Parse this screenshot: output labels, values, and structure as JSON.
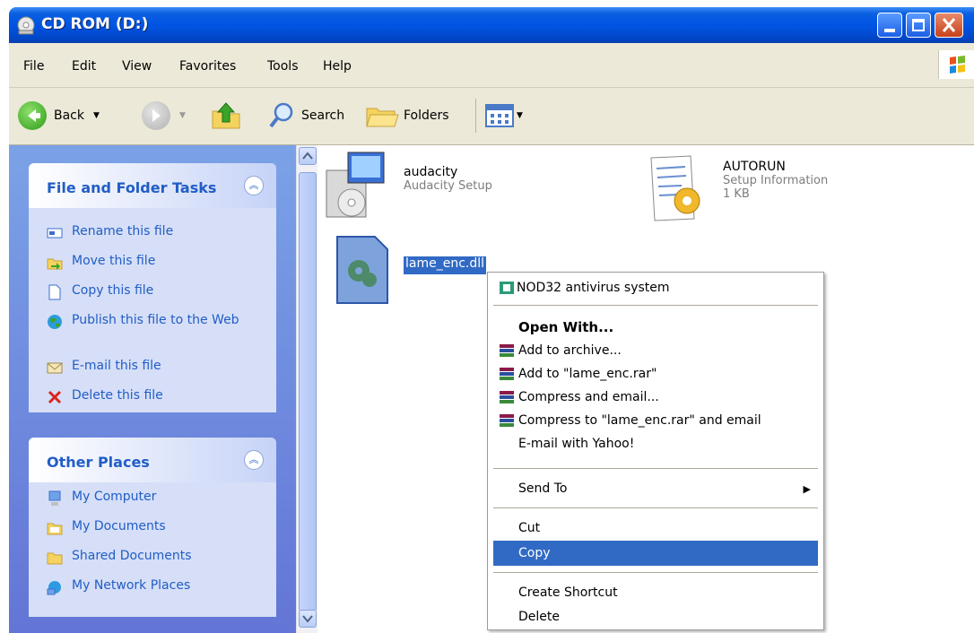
{
  "window": {
    "title": "CD ROM (D:)"
  },
  "menu": [
    "File",
    "Edit",
    "View",
    "Favorites",
    "Tools",
    "Help"
  ],
  "toolbar": {
    "back_label": "Back",
    "search_label": "Search",
    "folders_label": "Folders"
  },
  "file_tasks": {
    "title": "File and Folder Tasks",
    "items": [
      "Rename this file",
      "Move this file",
      "Copy this file",
      "Publish this file to the Web",
      "E-mail this file",
      "Delete this file"
    ]
  },
  "other_places": {
    "title": "Other Places",
    "items": [
      "My Computer",
      "My Documents",
      "Shared Documents",
      "My Network Places"
    ]
  },
  "files": [
    {
      "name": "audacity",
      "description": "Audacity Setup",
      "size": ""
    },
    {
      "name": "AUTORUN",
      "description": "Setup Information",
      "size": "1 KB"
    },
    {
      "name": "lame_enc.dll",
      "description": "",
      "size": ""
    }
  ],
  "context_menu": {
    "nod32": "NOD32 antivirus system",
    "open_with": "Open With...",
    "add_archive": "Add to archive...",
    "add_rar": "Add to \"lame_enc.rar\"",
    "compress_email": "Compress and email...",
    "compress_rar_email": "Compress to \"lame_enc.rar\" and email",
    "email_yahoo": "E-mail with Yahoo!",
    "send_to": "Send To",
    "cut": "Cut",
    "copy": "Copy",
    "create_shortcut": "Create Shortcut",
    "delete": "Delete"
  },
  "colors": {
    "titlebar": "#0054e3",
    "task_link": "#215dc6",
    "selection": "#316ac5"
  }
}
